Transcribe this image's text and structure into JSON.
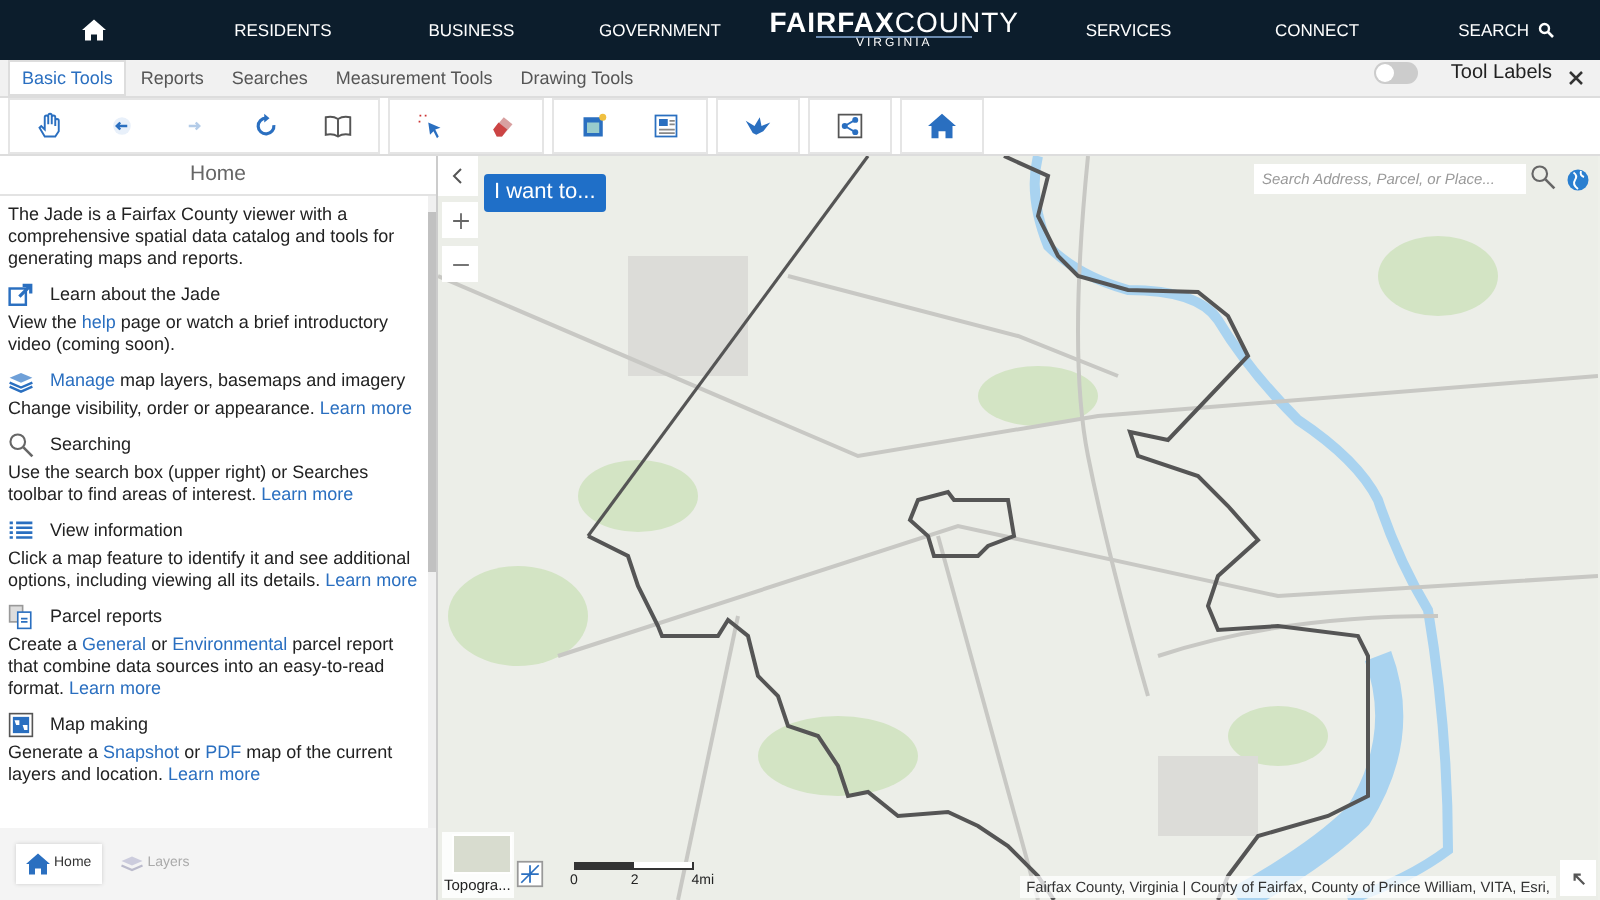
{
  "top_nav": {
    "items": [
      {
        "kind": "home"
      },
      {
        "kind": "link",
        "label": "RESIDENTS"
      },
      {
        "kind": "link",
        "label": "BUSINESS"
      },
      {
        "kind": "link",
        "label": "GOVERNMENT"
      },
      {
        "kind": "logo",
        "title_bold": "FAIRFAX",
        "title_light": "COUNTY",
        "subtitle": "VIRGINIA"
      },
      {
        "kind": "link",
        "label": "SERVICES"
      },
      {
        "kind": "link",
        "label": "CONNECT"
      },
      {
        "kind": "search",
        "label": "SEARCH"
      }
    ]
  },
  "tabs": [
    {
      "label": "Basic Tools",
      "selected": true
    },
    {
      "label": "Reports",
      "selected": false
    },
    {
      "label": "Searches",
      "selected": false
    },
    {
      "label": "Measurement Tools",
      "selected": false
    },
    {
      "label": "Drawing Tools",
      "selected": false
    }
  ],
  "tool_labels": {
    "label": "Tool Labels",
    "on": false
  },
  "toolbar": {
    "groups": [
      [
        {
          "disabled": false
        },
        {
          "disabled": false
        },
        {
          "disabled": true
        },
        {
          "disabled": false
        },
        {
          "disabled": false
        }
      ],
      [
        {
          "disabled": false
        },
        {
          "disabled": false
        }
      ],
      [
        {
          "disabled": false
        },
        {
          "disabled": false
        }
      ],
      [
        {
          "disabled": false
        }
      ],
      [
        {
          "disabled": false
        }
      ],
      [
        {
          "disabled": false
        }
      ]
    ]
  },
  "panel": {
    "title": "Home",
    "intro": "The Jade is a Fairfax County viewer with a comprehensive spatial data catalog and tools for generating maps and reports.",
    "sections": [
      {
        "heading": [
          {
            "text": "Learn about the Jade"
          }
        ],
        "text": [
          {
            "text": "View the "
          },
          {
            "text": "help",
            "link": true
          },
          {
            "text": " page or watch a brief introductory video (coming soon)."
          }
        ]
      },
      {
        "heading": [
          {
            "text": "Manage",
            "link": true
          },
          {
            "text": " map layers, basemaps and imagery"
          }
        ],
        "text": [
          {
            "text": "Change visibility, order or appearance. "
          },
          {
            "text": "Learn more",
            "link": true
          }
        ]
      },
      {
        "heading": [
          {
            "text": "Searching"
          }
        ],
        "text": [
          {
            "text": "Use the search box (upper right) or Searches toolbar to find areas of interest. "
          },
          {
            "text": "Learn more",
            "link": true
          }
        ]
      },
      {
        "heading": [
          {
            "text": "View information"
          }
        ],
        "text": [
          {
            "text": "Click a map feature to identify it and see additional options, including viewing all its details. "
          },
          {
            "text": "Learn more",
            "link": true
          }
        ]
      },
      {
        "heading": [
          {
            "text": "Parcel reports"
          }
        ],
        "text": [
          {
            "text": "Create a "
          },
          {
            "text": "General",
            "link": true
          },
          {
            "text": " or "
          },
          {
            "text": "Environmental",
            "link": true
          },
          {
            "text": " parcel report that combine data sources into an easy-to-read format. "
          },
          {
            "text": "Learn more",
            "link": true
          }
        ]
      },
      {
        "heading": [
          {
            "text": "Map making"
          }
        ],
        "text": [
          {
            "text": "Generate a "
          },
          {
            "text": "Snapshot",
            "link": true
          },
          {
            "text": " or "
          },
          {
            "text": "PDF",
            "link": true
          },
          {
            "text": " map of the current layers and location. "
          },
          {
            "text": "Learn more",
            "link": true
          }
        ]
      }
    ],
    "bottom_tabs": [
      {
        "label": "Home",
        "selected": true
      },
      {
        "label": "Layers",
        "selected": false
      }
    ]
  },
  "map": {
    "action_button": "I want to...",
    "search": {
      "placeholder": "Search Address, Parcel, or Place..."
    },
    "basemap_label": "Topogra...",
    "scale_labels": [
      "0",
      "2",
      "4mi"
    ],
    "attribution": "Fairfax County, Virginia | County of Fairfax, County of Prince William, VITA, Esri,"
  }
}
